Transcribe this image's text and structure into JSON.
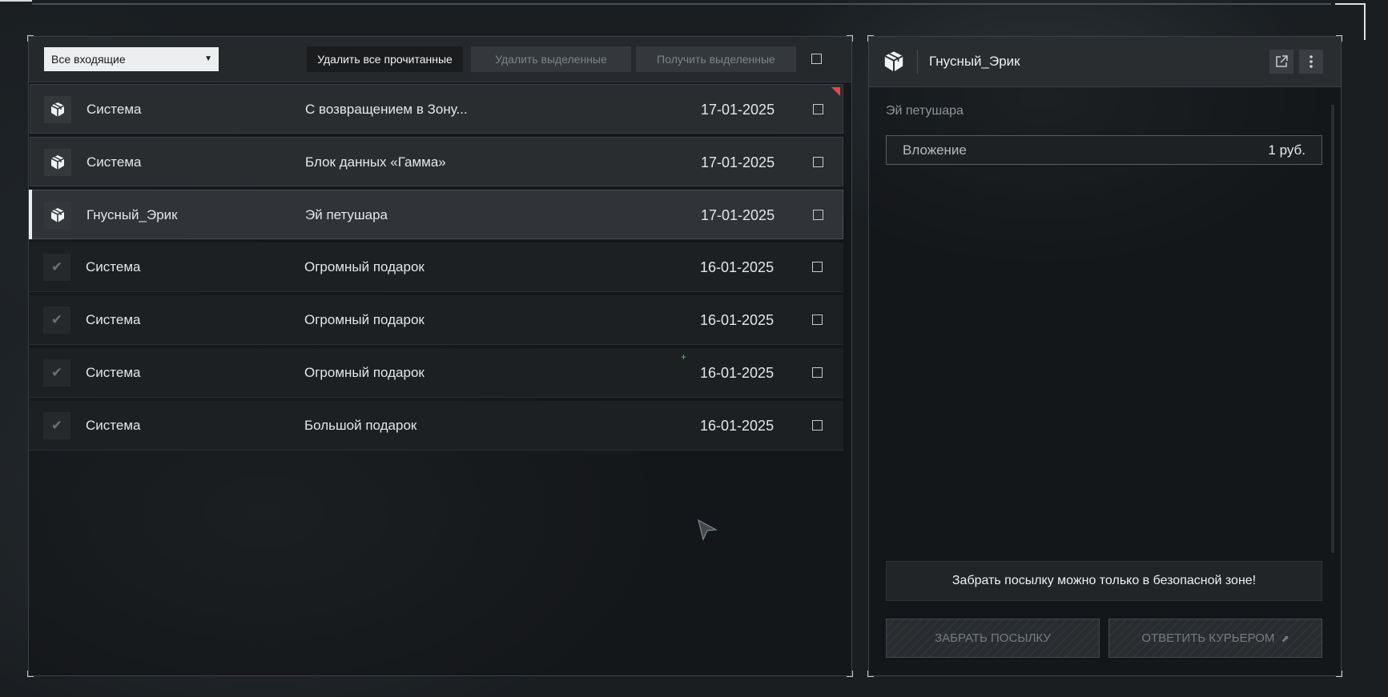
{
  "filter": {
    "selected": "Все входящие"
  },
  "toolbar": {
    "delete_read": "Удалить все прочитанные",
    "delete_selected": "Удалить выделенные",
    "get_selected": "Получить выделенные"
  },
  "messages": [
    {
      "sender": "Система",
      "subject": "С возвращением в Зону...",
      "date": "17-01-2025",
      "icon": "package-icon",
      "state": "unread",
      "flag": true
    },
    {
      "sender": "Система",
      "subject": "Блок данных «Гамма»",
      "date": "17-01-2025",
      "icon": "package-icon",
      "state": "unread",
      "flag": false
    },
    {
      "sender": "Гнусный_Эрик",
      "subject": "Эй петушара",
      "date": "17-01-2025",
      "icon": "package-icon",
      "state": "selected",
      "flag": false
    },
    {
      "sender": "Система",
      "subject": "Огромный подарок",
      "date": "16-01-2025",
      "icon": "check-icon",
      "state": "read",
      "flag": false
    },
    {
      "sender": "Система",
      "subject": "Огромный подарок",
      "date": "16-01-2025",
      "icon": "check-icon",
      "state": "read",
      "flag": false
    },
    {
      "sender": "Система",
      "subject": "Огромный подарок",
      "date": "16-01-2025",
      "icon": "check-icon",
      "state": "read",
      "flag": false
    },
    {
      "sender": "Система",
      "subject": "Большой подарок",
      "date": "16-01-2025",
      "icon": "check-icon",
      "state": "read",
      "flag": false
    }
  ],
  "detail": {
    "sender": "Гнусный_Эрик",
    "subject": "Эй петушара",
    "attachment_label": "Вложение",
    "attachment_value": "1 руб.",
    "notice": "Забрать посылку можно только в безопасной зоне!",
    "take_button": "ЗАБРАТЬ ПОСЫЛКУ",
    "reply_button": "ОТВЕТИТЬ КУРЬЕРОМ"
  },
  "colors": {
    "accent": "#eceeef",
    "unread_flag": "#e2474a",
    "background": "#1a1e21"
  }
}
